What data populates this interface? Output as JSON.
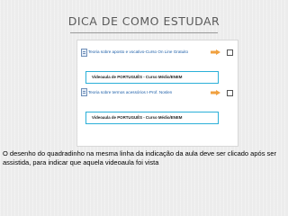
{
  "title": "DICA DE COMO ESTUDAR",
  "screenshot": {
    "link1": "Teoria sobre aposto e vocativo-Curso On Line Gratuito",
    "video1": "Videoaula de PORTUGUÊS - Curso Médio/ENEM",
    "link2": "Teoria sobre termos acessórios I-Prof. Noslen",
    "video2": "Videoaula de PORTUGUÊS - Curso Médio/ENEM"
  },
  "caption": "O desenho do quadradinho na mesma linha da indicação da aula deve ser clicado após ser assistida, para indicar que aquela videoaula foi vista",
  "colors": {
    "arrow": "#f0a140",
    "video_border": "#2bb0d8",
    "link": "#1d5fa8"
  }
}
